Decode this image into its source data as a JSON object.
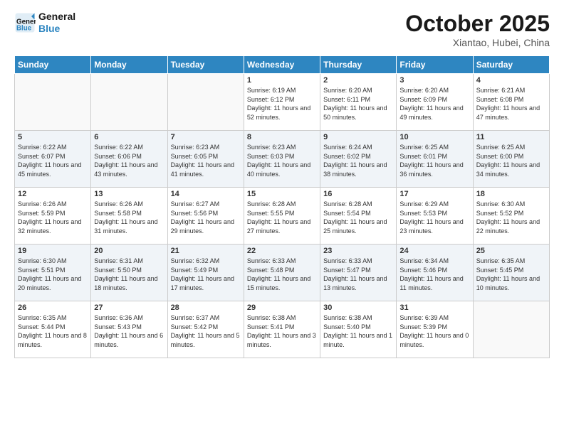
{
  "logo": {
    "line1": "General",
    "line2": "Blue"
  },
  "title": "October 2025",
  "subtitle": "Xiantao, Hubei, China",
  "days_header": [
    "Sunday",
    "Monday",
    "Tuesday",
    "Wednesday",
    "Thursday",
    "Friday",
    "Saturday"
  ],
  "weeks": [
    [
      {
        "day": "",
        "sunrise": "",
        "sunset": "",
        "daylight": ""
      },
      {
        "day": "",
        "sunrise": "",
        "sunset": "",
        "daylight": ""
      },
      {
        "day": "",
        "sunrise": "",
        "sunset": "",
        "daylight": ""
      },
      {
        "day": "1",
        "sunrise": "Sunrise: 6:19 AM",
        "sunset": "Sunset: 6:12 PM",
        "daylight": "Daylight: 11 hours and 52 minutes."
      },
      {
        "day": "2",
        "sunrise": "Sunrise: 6:20 AM",
        "sunset": "Sunset: 6:11 PM",
        "daylight": "Daylight: 11 hours and 50 minutes."
      },
      {
        "day": "3",
        "sunrise": "Sunrise: 6:20 AM",
        "sunset": "Sunset: 6:09 PM",
        "daylight": "Daylight: 11 hours and 49 minutes."
      },
      {
        "day": "4",
        "sunrise": "Sunrise: 6:21 AM",
        "sunset": "Sunset: 6:08 PM",
        "daylight": "Daylight: 11 hours and 47 minutes."
      }
    ],
    [
      {
        "day": "5",
        "sunrise": "Sunrise: 6:22 AM",
        "sunset": "Sunset: 6:07 PM",
        "daylight": "Daylight: 11 hours and 45 minutes."
      },
      {
        "day": "6",
        "sunrise": "Sunrise: 6:22 AM",
        "sunset": "Sunset: 6:06 PM",
        "daylight": "Daylight: 11 hours and 43 minutes."
      },
      {
        "day": "7",
        "sunrise": "Sunrise: 6:23 AM",
        "sunset": "Sunset: 6:05 PM",
        "daylight": "Daylight: 11 hours and 41 minutes."
      },
      {
        "day": "8",
        "sunrise": "Sunrise: 6:23 AM",
        "sunset": "Sunset: 6:03 PM",
        "daylight": "Daylight: 11 hours and 40 minutes."
      },
      {
        "day": "9",
        "sunrise": "Sunrise: 6:24 AM",
        "sunset": "Sunset: 6:02 PM",
        "daylight": "Daylight: 11 hours and 38 minutes."
      },
      {
        "day": "10",
        "sunrise": "Sunrise: 6:25 AM",
        "sunset": "Sunset: 6:01 PM",
        "daylight": "Daylight: 11 hours and 36 minutes."
      },
      {
        "day": "11",
        "sunrise": "Sunrise: 6:25 AM",
        "sunset": "Sunset: 6:00 PM",
        "daylight": "Daylight: 11 hours and 34 minutes."
      }
    ],
    [
      {
        "day": "12",
        "sunrise": "Sunrise: 6:26 AM",
        "sunset": "Sunset: 5:59 PM",
        "daylight": "Daylight: 11 hours and 32 minutes."
      },
      {
        "day": "13",
        "sunrise": "Sunrise: 6:26 AM",
        "sunset": "Sunset: 5:58 PM",
        "daylight": "Daylight: 11 hours and 31 minutes."
      },
      {
        "day": "14",
        "sunrise": "Sunrise: 6:27 AM",
        "sunset": "Sunset: 5:56 PM",
        "daylight": "Daylight: 11 hours and 29 minutes."
      },
      {
        "day": "15",
        "sunrise": "Sunrise: 6:28 AM",
        "sunset": "Sunset: 5:55 PM",
        "daylight": "Daylight: 11 hours and 27 minutes."
      },
      {
        "day": "16",
        "sunrise": "Sunrise: 6:28 AM",
        "sunset": "Sunset: 5:54 PM",
        "daylight": "Daylight: 11 hours and 25 minutes."
      },
      {
        "day": "17",
        "sunrise": "Sunrise: 6:29 AM",
        "sunset": "Sunset: 5:53 PM",
        "daylight": "Daylight: 11 hours and 23 minutes."
      },
      {
        "day": "18",
        "sunrise": "Sunrise: 6:30 AM",
        "sunset": "Sunset: 5:52 PM",
        "daylight": "Daylight: 11 hours and 22 minutes."
      }
    ],
    [
      {
        "day": "19",
        "sunrise": "Sunrise: 6:30 AM",
        "sunset": "Sunset: 5:51 PM",
        "daylight": "Daylight: 11 hours and 20 minutes."
      },
      {
        "day": "20",
        "sunrise": "Sunrise: 6:31 AM",
        "sunset": "Sunset: 5:50 PM",
        "daylight": "Daylight: 11 hours and 18 minutes."
      },
      {
        "day": "21",
        "sunrise": "Sunrise: 6:32 AM",
        "sunset": "Sunset: 5:49 PM",
        "daylight": "Daylight: 11 hours and 17 minutes."
      },
      {
        "day": "22",
        "sunrise": "Sunrise: 6:33 AM",
        "sunset": "Sunset: 5:48 PM",
        "daylight": "Daylight: 11 hours and 15 minutes."
      },
      {
        "day": "23",
        "sunrise": "Sunrise: 6:33 AM",
        "sunset": "Sunset: 5:47 PM",
        "daylight": "Daylight: 11 hours and 13 minutes."
      },
      {
        "day": "24",
        "sunrise": "Sunrise: 6:34 AM",
        "sunset": "Sunset: 5:46 PM",
        "daylight": "Daylight: 11 hours and 11 minutes."
      },
      {
        "day": "25",
        "sunrise": "Sunrise: 6:35 AM",
        "sunset": "Sunset: 5:45 PM",
        "daylight": "Daylight: 11 hours and 10 minutes."
      }
    ],
    [
      {
        "day": "26",
        "sunrise": "Sunrise: 6:35 AM",
        "sunset": "Sunset: 5:44 PM",
        "daylight": "Daylight: 11 hours and 8 minutes."
      },
      {
        "day": "27",
        "sunrise": "Sunrise: 6:36 AM",
        "sunset": "Sunset: 5:43 PM",
        "daylight": "Daylight: 11 hours and 6 minutes."
      },
      {
        "day": "28",
        "sunrise": "Sunrise: 6:37 AM",
        "sunset": "Sunset: 5:42 PM",
        "daylight": "Daylight: 11 hours and 5 minutes."
      },
      {
        "day": "29",
        "sunrise": "Sunrise: 6:38 AM",
        "sunset": "Sunset: 5:41 PM",
        "daylight": "Daylight: 11 hours and 3 minutes."
      },
      {
        "day": "30",
        "sunrise": "Sunrise: 6:38 AM",
        "sunset": "Sunset: 5:40 PM",
        "daylight": "Daylight: 11 hours and 1 minute."
      },
      {
        "day": "31",
        "sunrise": "Sunrise: 6:39 AM",
        "sunset": "Sunset: 5:39 PM",
        "daylight": "Daylight: 11 hours and 0 minutes."
      },
      {
        "day": "",
        "sunrise": "",
        "sunset": "",
        "daylight": ""
      }
    ]
  ]
}
